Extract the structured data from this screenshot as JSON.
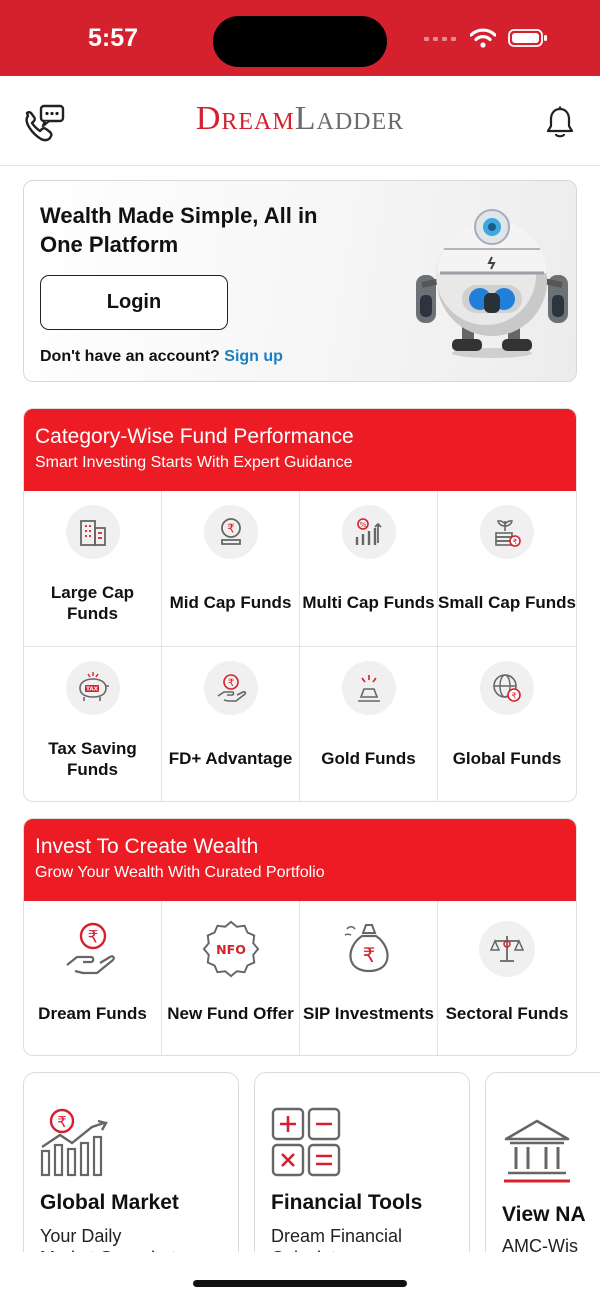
{
  "status_bar": {
    "time": "5:57"
  },
  "header": {
    "brand_part1": "Dream",
    "brand_part2": "Ladder",
    "support_icon": "phone-chat-icon",
    "bell_icon": "bell-icon"
  },
  "hero": {
    "title": "Wealth Made Simple, All in One Platform",
    "login_label": "Login",
    "signup_prompt": "Don't have an account?",
    "signup_link": "Sign up"
  },
  "category_section": {
    "title": "Category-Wise Fund Performance",
    "subtitle": "Smart Investing Starts With Expert Guidance",
    "items": [
      {
        "label": "Large Cap Funds",
        "icon": "building-icon"
      },
      {
        "label": "Mid Cap Funds",
        "icon": "rupee-coin-stand-icon"
      },
      {
        "label": "Multi Cap Funds",
        "icon": "percent-growth-icon"
      },
      {
        "label": "Small Cap Funds",
        "icon": "plant-coins-icon"
      },
      {
        "label": "Tax Saving Funds",
        "icon": "tax-piggy-icon"
      },
      {
        "label": "FD+ Advantage",
        "icon": "hand-rupee-coin-icon"
      },
      {
        "label": "Gold Funds",
        "icon": "gold-bars-icon"
      },
      {
        "label": "Global Funds",
        "icon": "globe-rupee-icon"
      }
    ]
  },
  "invest_section": {
    "title": "Invest To Create Wealth",
    "subtitle": "Grow Your Wealth With Curated Portfolio",
    "items": [
      {
        "label": "Dream Funds",
        "icon": "hand-rupee-icon"
      },
      {
        "label": "New Fund Offer",
        "icon": "nfo-badge-icon"
      },
      {
        "label": "SIP Investments",
        "icon": "money-bag-icon"
      },
      {
        "label": "Sectoral Funds",
        "icon": "scales-icon"
      }
    ]
  },
  "bottom_cards": [
    {
      "title": "Global Market",
      "subtitle": "Your Daily",
      "subtitle2": "Market Snapshot",
      "icon": "rupee-chart-icon"
    },
    {
      "title": "Financial Tools",
      "subtitle": "Dream Financial",
      "subtitle2": "Calculators",
      "icon": "calculator-icon"
    },
    {
      "title": "View NA",
      "subtitle": "AMC-Wis",
      "icon": "bank-icon"
    }
  ],
  "colors": {
    "brand_red": "#ed1c24",
    "status_red": "#d5202e",
    "link_blue": "#1a7fc1"
  }
}
